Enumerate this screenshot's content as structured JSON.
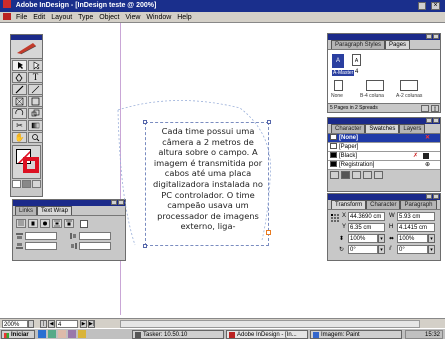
{
  "window": {
    "title": "Adobe InDesign - [InDesign teste @ 200%]"
  },
  "menu": [
    "File",
    "Edit",
    "Layout",
    "Type",
    "Object",
    "View",
    "Window",
    "Help"
  ],
  "pages_panel": {
    "tab_paragraph": "Paragraph Styles",
    "tab_pages": "Pages",
    "master_label": "A-Master",
    "master_short": "A",
    "page_label": "A",
    "page_number": "4",
    "masters": [
      "None",
      "B-4 coluna",
      "A-2 colunas"
    ],
    "footer": "5 Pages in 2 Spreads"
  },
  "swatches_panel": {
    "tab_character": "Character",
    "tab_swatches": "Swatches",
    "tab_layers": "Layers",
    "items": [
      {
        "name": "[None]",
        "color": "#ffffff",
        "selected": true
      },
      {
        "name": "[Paper]",
        "color": "#ffffff",
        "selected": false
      },
      {
        "name": "[Black]",
        "color": "#000000",
        "selected": false
      },
      {
        "name": "[Registration]",
        "color": "#000000",
        "selected": false
      }
    ]
  },
  "transform_panel": {
    "tab_transform": "Transform",
    "tab_character": "Character",
    "tab_paragraph": "Paragraph",
    "x_label": "X",
    "x_value": "44.3690 cm",
    "y_label": "Y",
    "y_value": "6.35 cm",
    "w_label": "W",
    "w_value": "5.93 cm",
    "h_label": "H",
    "h_value": "4.1415 cm",
    "scale_x": "100%",
    "scale_y": "100%",
    "rotate": "0°",
    "shear": "0°"
  },
  "textwrap_panel": {
    "tab_links": "Links",
    "tab_textwrap": "Text Wrap"
  },
  "document": {
    "body_text": "Cada time possui uma câmera a 2 metros de altura sobre o campo. A imagem é transmitida por cabos até uma placa digitalizadora instalada no PC controlador. O time campeão usava um processador de imagens externo, liga-"
  },
  "status": {
    "zoom": "200%",
    "page": "4"
  },
  "taskbar": {
    "start": "Iniciar",
    "items": [
      "Tasker: 10.50.10",
      "Adobe InDesign - [In...",
      "Imagem: Paint"
    ],
    "clock": "15:32"
  },
  "colors": {
    "title_blue": "#1a2f8c",
    "chrome_gray": "#c8c8c8",
    "frame_orange": "#e87a20"
  }
}
